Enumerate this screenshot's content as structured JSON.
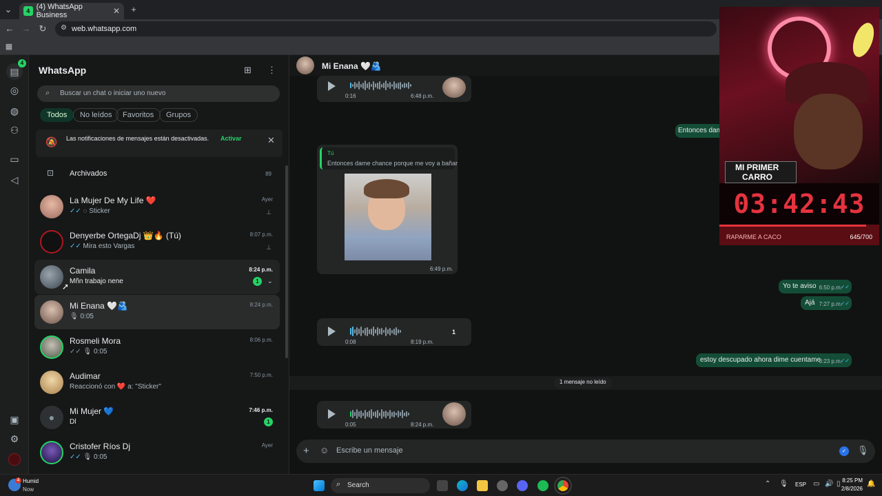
{
  "browser": {
    "tab_title": "(4) WhatsApp Business",
    "tab_badge": "4",
    "url": "web.whatsapp.com"
  },
  "rail": {
    "chats_badge": "4"
  },
  "sidebar": {
    "title": "WhatsApp",
    "search_placeholder": "Buscar un chat o iniciar uno nuevo",
    "filters": [
      "Todos",
      "No leídos",
      "Favoritos",
      "Grupos"
    ],
    "notice_text": "Las notificaciones de mensajes están desactivadas.",
    "notice_action": "Activar",
    "archived_label": "Archivados",
    "archived_count": "89",
    "chats": [
      {
        "name": "La Mujer De My Life ❤️",
        "preview": "Sticker",
        "time": "Ayer",
        "pinned": true
      },
      {
        "name": "Denyerbe OrtegaDj 👑🔥 (Tú)",
        "preview": "Mira esto Vargas",
        "time": "8:07 p.m.",
        "pinned": true
      },
      {
        "name": "Camila",
        "preview": "Mñn trabajo nene",
        "time": "8:24 p.m.",
        "unread": "1"
      },
      {
        "name": "Mi Enana 🤍🫂",
        "preview": "0:05",
        "time": "8:24 p.m."
      },
      {
        "name": "Rosmeli Mora",
        "preview": "0:05",
        "time": "8:06 p.m."
      },
      {
        "name": "Audimar",
        "preview": "Reaccionó con ❤️ a: \"Sticker\"",
        "time": "7:50 p.m."
      },
      {
        "name": "Mi Mujer 💙",
        "preview": "Dl",
        "time": "7:46 p.m.",
        "unread": "1"
      },
      {
        "name": "Cristofer Ríos Dj",
        "preview": "0:05",
        "time": "Ayer"
      }
    ]
  },
  "chat": {
    "contact_name": "Mi Enana 🤍🫂",
    "messages": {
      "voice1_duration": "0:16",
      "voice1_time": "6:48 p.m.",
      "out_truncated": "Entonces dam",
      "reply_author": "Tú",
      "reply_quote": "Entonces dame chance porque me voy a bañar",
      "image_time": "6:49 p.m.",
      "out2_text": "Yo te aviso",
      "out2_time": "6:50 p.m.",
      "out3_text": "Ajá",
      "out3_time": "7:27 p.m.",
      "voice2_duration": "0:08",
      "voice2_time": "8:19 p.m.",
      "voice2_speed": "1",
      "out4_text": "estoy descupado ahora dime cuentame",
      "out4_time": "8:23 p.m.",
      "unread_divider": "1 mensaje no leído",
      "voice3_duration": "0:05",
      "voice3_time": "8:24 p.m."
    },
    "composer_placeholder": "Escribe un mensaje"
  },
  "stream": {
    "banner_line1": "MI PRIMER",
    "banner_line2": "CARRO",
    "timer": "03:42:43",
    "goal_label": "RAPARME A CACO",
    "goal_count": "645/700",
    "goal_progress": 0.92
  },
  "taskbar": {
    "weather_label": "Humid",
    "weather_sub": "Now",
    "weather_badge": "4",
    "search_label": "Search",
    "lang": "ESP",
    "time": "8:25 PM",
    "date": "2/8/2026"
  }
}
